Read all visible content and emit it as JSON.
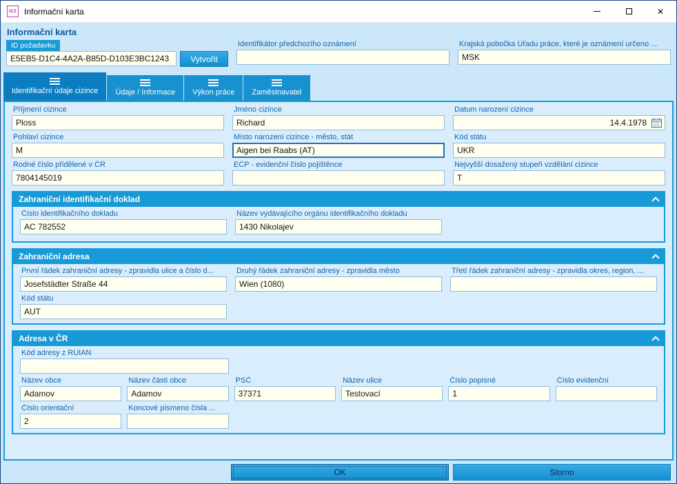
{
  "window": {
    "title": "Informační karta"
  },
  "header": {
    "title": "Informační karta"
  },
  "top": {
    "id_pozadavku": {
      "label": "ID požadavku",
      "value": "E5EB5-D1C4-4A2A-B85D-D103E3BC1243"
    },
    "vytvorit_button": "Vytvořit",
    "predchozi_oznameni": {
      "label": "Identifikátor předchozího oznámení",
      "value": ""
    },
    "krajska_pobocka": {
      "label": "Krajská pobočka Úřadu práce, které je oznámení určeno ...",
      "value": "MSK"
    }
  },
  "tabs": [
    {
      "label": "Identifikační údaje cizince",
      "active": true
    },
    {
      "label": "Údaje / Informace",
      "active": false
    },
    {
      "label": "Výkon práce",
      "active": false
    },
    {
      "label": "Zaměstnavatel",
      "active": false
    }
  ],
  "form": {
    "prijmeni": {
      "label": "Příjmení cizince",
      "value": "Ploss"
    },
    "jmeno": {
      "label": "Jméno cizince",
      "value": "Richard"
    },
    "datum_narozeni": {
      "label": "Datum narození cizince",
      "value": "14.4.1978"
    },
    "pohlavi": {
      "label": "Pohlaví cizince",
      "value": "M"
    },
    "misto_narozeni": {
      "label": "Místo narození cizince - město, stát",
      "value": "Aigen bei Raabs (AT)"
    },
    "kod_statu": {
      "label": "Kód státu",
      "value": "UKR"
    },
    "rodne_cislo": {
      "label": "Rodné číslo přidělené v ČR",
      "value": "7804145019"
    },
    "ecp": {
      "label": "EČP - evidenční číslo pojištěnce",
      "value": ""
    },
    "vzdelani": {
      "label": "Nejvyšší dosažený stupeň vzdělání cizince",
      "value": "T"
    }
  },
  "sections": {
    "doklad": {
      "title": "Zahraniční identifikační doklad",
      "cislo_dokladu": {
        "label": "Číslo identifikačního dokladu",
        "value": "AC 782552"
      },
      "nazev_organu": {
        "label": "Název vydávajícího orgánu identifikačního dokladu",
        "value": "1430 Nikolajev"
      }
    },
    "zahranicni_adresa": {
      "title": "Zahraniční adresa",
      "radek1": {
        "label": "První řádek zahraniční adresy - zpravidla ulice a číslo d...",
        "value": "Josefstädter Straße 44"
      },
      "radek2": {
        "label": "Druhý řádek zahraniční adresy - zpravidla město",
        "value": "Wien (1080)"
      },
      "radek3": {
        "label": "Třetí řádek zahraniční adresy - zpravidla okres, region, ...",
        "value": ""
      },
      "kod_statu": {
        "label": "Kód státu",
        "value": "AUT"
      }
    },
    "adresa_cr": {
      "title": "Adresa v ČR",
      "ruian": {
        "label": "Kód adresy z RUIAN",
        "value": ""
      },
      "obec": {
        "label": "Název obce",
        "value": "Adamov"
      },
      "cast_obce": {
        "label": "Název části obce",
        "value": "Adamov"
      },
      "psc": {
        "label": "PSČ",
        "value": "37371"
      },
      "ulice": {
        "label": "Název ulice",
        "value": "Testovací"
      },
      "cislo_popisne": {
        "label": "Číslo popisné",
        "value": "1"
      },
      "cislo_evidencni": {
        "label": "Číslo evidenční",
        "value": ""
      },
      "cislo_orientacni": {
        "label": "Číslo orientační",
        "value": "2"
      },
      "koncove_pismeno": {
        "label": "Koncové písmeno čísla ...",
        "value": ""
      }
    }
  },
  "footer": {
    "ok": "OK",
    "storno": "Storno"
  },
  "icons": {
    "app_logo": "ICZ"
  },
  "colors": {
    "accent_blue": "#179ad7",
    "active_tab": "#0c7dc0",
    "input_bg": "#fffff0",
    "label_blue": "#1465a9"
  }
}
